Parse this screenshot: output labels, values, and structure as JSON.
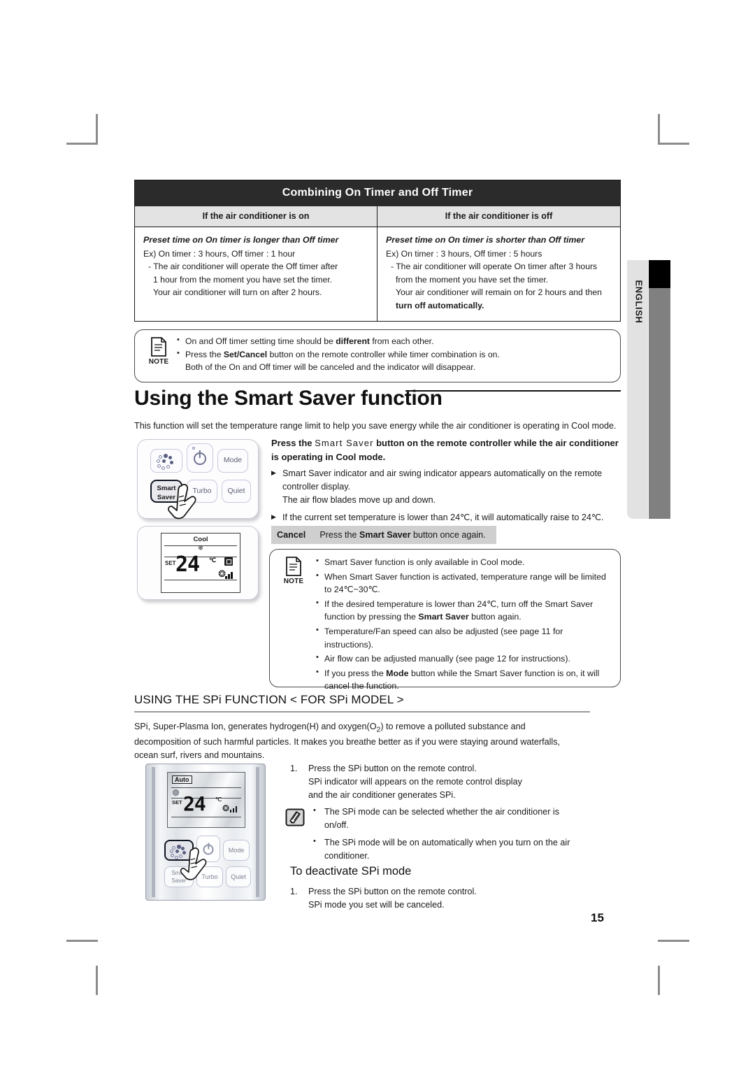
{
  "sidebar": {
    "language": "ENGLISH"
  },
  "timer_table": {
    "title": "Combining On Timer and Off Timer",
    "headers": [
      "If the air conditioner is on",
      "If the air conditioner is off"
    ],
    "left": {
      "heading": "Preset time on On timer is longer than Off timer",
      "example": "Ex) On timer : 3 hours, Off timer : 1 hour",
      "line1": "- The air conditioner will operate the Off timer after",
      "line2": "1 hour from the moment you have set the timer.",
      "line3": "Your air conditioner will turn on after 2 hours."
    },
    "right": {
      "heading": "Preset time on On timer is shorter than Off timer",
      "example": "Ex) On timer : 3 hours, Off timer : 5 hours",
      "line1": "- The air conditioner will operate On timer after 3 hours",
      "line2": "from the moment you have set the timer.",
      "line3": "Your air conditioner will remain on for 2 hours and then",
      "line4": "turn off automatically."
    }
  },
  "note_timer": {
    "label": "NOTE",
    "items": [
      {
        "pre": "On and  Off timer setting time should be ",
        "bold": "different",
        "post": " from each other."
      },
      {
        "pre": "Press the ",
        "bold": "Set/Cancel",
        "post": "  button on the remote controller while timer combination is on."
      },
      {
        "pre": "Both of the On and Off timer will be canceled and the indicator will disappear.",
        "bold": "",
        "post": ""
      }
    ]
  },
  "smart_saver": {
    "heading": "Using the Smart Saver function",
    "intro": "This function will set the temperature range limit to help you save energy while the air conditioner is operating in Cool mode.",
    "lead_pre": "Press the ",
    "lead_button": "Smart Saver",
    "lead_post": " button on the remote controller while the air conditioner is operating in Cool mode.",
    "bullets": [
      "Smart Saver indicator and air swing indicator appears automatically on the remote controller display.",
      "The air flow blades move up and down.",
      "If the current set temperature is lower than 24℃, it will automatically raise to 24℃."
    ],
    "cancel_label": "Cancel",
    "cancel_pre": "Press the ",
    "cancel_bold": "Smart Saver",
    "cancel_post": " button once again."
  },
  "note_smart": {
    "label": "NOTE",
    "items": [
      {
        "pre": "Smart Saver function is only available in Cool mode.",
        "bold": "",
        "post": ""
      },
      {
        "pre": "When Smart Saver function is activated, temperature range will be limited to 24℃~30℃.",
        "bold": "",
        "post": ""
      },
      {
        "pre": "If the desired temperature is lower than 24℃, turn off the Smart Saver function by pressing the ",
        "bold": "Smart Saver",
        "post": " button again."
      },
      {
        "pre": "Temperature/Fan speed can also be adjusted (see page 11 for instructions).",
        "bold": "",
        "post": ""
      },
      {
        "pre": "Air flow can be adjusted manually (see page 12 for instructions).",
        "bold": "",
        "post": ""
      },
      {
        "pre": "If you press the ",
        "bold": "Mode",
        "post": " button while the Smart Saver function is on, it will cancel the function."
      }
    ]
  },
  "spi": {
    "heading": "USING THE SPi FUNCTION < FOR SPi MODEL >",
    "intro_line1": "SPi, Super-Plasma Ion, generates hydrogen(H) and oxygen(O",
    "intro_sub": "2",
    "intro_line1b": ") to remove a polluted substance and",
    "intro_line2": "decomposition of such harmful particles. It makes you breathe better as if you were staying around",
    "intro_line3": "waterfalls, ocean surf, rivers and mountains.",
    "step1_num": "1.",
    "step1_l1": "Press the SPi button on the remote control.",
    "step1_l2": "SPi indicator will appears on the remote control display",
    "step1_l3": "and the air conditioner generates SPi.",
    "note_items": [
      "The SPi mode can be selected whether the air conditioner is on/off.",
      "The SPi mode will be on automatically when you turn on the air conditioner."
    ],
    "subheading": "To deactivate SPi mode",
    "step2_num": "1.",
    "step2_l1": "Press the SPi button on the remote control.",
    "step2_l2": "SPi mode you set will be canceled."
  },
  "remote_smart": {
    "keys": {
      "spi": "",
      "power": "",
      "mode": "Mode",
      "smart1": "Smart",
      "smart2": "Saver",
      "turbo": "Turbo",
      "quiet": "Quiet"
    },
    "lcd": {
      "mode": "Cool",
      "set_label": "SET",
      "temperature": "24",
      "unit": "℃"
    }
  },
  "remote_spi": {
    "keys": {
      "spi": "",
      "power": "",
      "mode": "Mode",
      "smart1": "Smart",
      "smart2": "Saver",
      "turbo": "Turbo",
      "quiet": "Quiet"
    },
    "lcd": {
      "mode": "Auto",
      "set_label": "SET",
      "temperature": "24",
      "unit": "℃"
    }
  },
  "page": {
    "number": "15"
  }
}
